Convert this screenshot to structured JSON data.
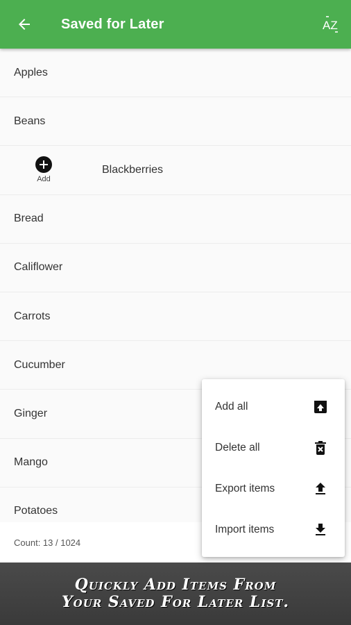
{
  "appbar": {
    "title": "Saved for Later",
    "back_icon": "arrow-left-icon",
    "sort_icon": "sort-alpha-icon",
    "sort_glyph": "AZ",
    "background": "#4caf50"
  },
  "list": {
    "items": [
      {
        "label": "Apples"
      },
      {
        "label": "Beans"
      },
      {
        "label": "Blackberries",
        "action_label": "Add"
      },
      {
        "label": "Bread"
      },
      {
        "label": "Califlower"
      },
      {
        "label": "Carrots"
      },
      {
        "label": "Cucumber"
      },
      {
        "label": "Ginger"
      },
      {
        "label": "Mango"
      },
      {
        "label": "Potatoes"
      }
    ]
  },
  "footer": {
    "count_text": "Count: 13 / 1024"
  },
  "menu": {
    "items": [
      {
        "label": "Add all",
        "icon": "archive-upload-icon"
      },
      {
        "label": "Delete all",
        "icon": "trash-x-icon"
      },
      {
        "label": "Export items",
        "icon": "upload-icon"
      },
      {
        "label": "Import items",
        "icon": "download-icon"
      }
    ]
  },
  "banner": {
    "line1": "Quickly Add Items From",
    "line2": "Your Saved For Later List."
  }
}
